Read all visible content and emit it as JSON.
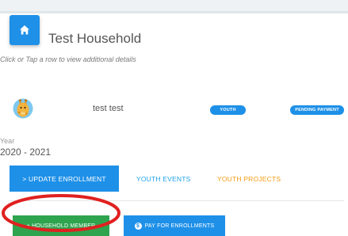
{
  "household": {
    "title": "Test Household",
    "hint": "Click or Tap a row to view additional details"
  },
  "member": {
    "name": "test test",
    "type_badge": "YOUTH",
    "status_badge": "PENDING PAYMENT",
    "avatar_icon": "giraffe-avatar-icon"
  },
  "enrollment": {
    "year_label": "Year",
    "year_value": "2020 - 2021"
  },
  "actions": {
    "update_enrollment": "> UPDATE ENROLLMENT",
    "youth_events": "YOUTH EVENTS",
    "youth_projects": "YOUTH PROJECTS",
    "add_household_member": "+ HOUSEHOLD MEMBER",
    "pay_for_enrollments": "PAY FOR ENROLLMENTS"
  },
  "colors": {
    "primary": "#1e90e8",
    "success": "#2ea44f",
    "accent_orange": "#f39c12",
    "highlight_circle": "#e02020"
  }
}
